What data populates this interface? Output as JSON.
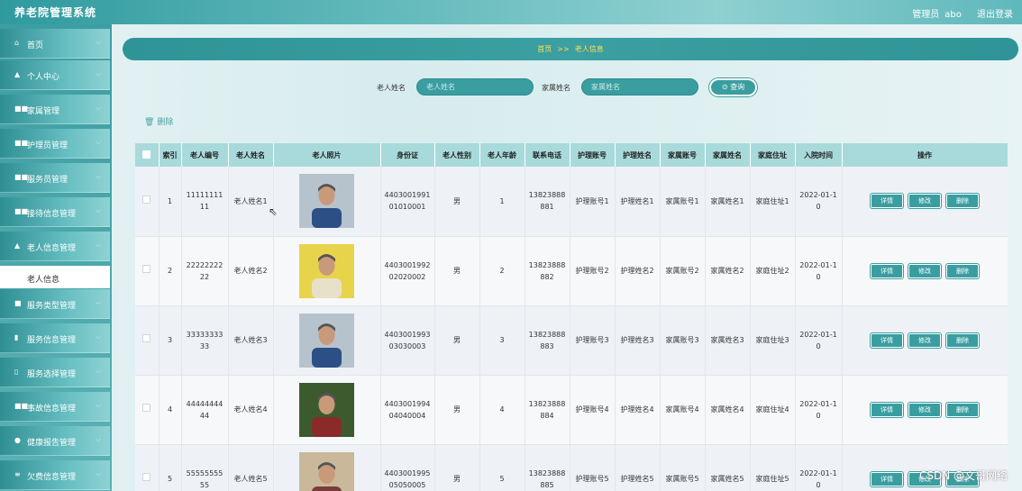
{
  "app": {
    "title": "养老院管理系统"
  },
  "topbar": {
    "role": "管理员",
    "username": "abo",
    "logout": "退出登录"
  },
  "sidebar": {
    "items": [
      {
        "icon": "home-icon",
        "glyph": "⌂",
        "label": "首页"
      },
      {
        "icon": "user-icon",
        "glyph": "▲",
        "label": "个人中心"
      },
      {
        "icon": "grid-icon",
        "glyph": "■■",
        "label": "家属管理"
      },
      {
        "icon": "grid-icon",
        "glyph": "■■",
        "label": "护理员管理"
      },
      {
        "icon": "grid-icon",
        "glyph": "■■",
        "label": "服务员管理"
      },
      {
        "icon": "grid-icon",
        "glyph": "■■",
        "label": "接待信息管理"
      },
      {
        "icon": "house-icon",
        "glyph": "▲",
        "label": "老人信息管理"
      },
      {
        "icon": "list-icon",
        "glyph": "■",
        "label": "服务类型管理"
      },
      {
        "icon": "chart-icon",
        "glyph": "▮",
        "label": "服务信息管理"
      },
      {
        "icon": "doc-icon",
        "glyph": "▯",
        "label": "服务选择管理"
      },
      {
        "icon": "grid-icon",
        "glyph": "■■",
        "label": "事故信息管理"
      },
      {
        "icon": "pin-icon",
        "glyph": "●",
        "label": "健康报告管理"
      },
      {
        "icon": "menu-icon",
        "glyph": "≡",
        "label": "欠费信息管理"
      }
    ],
    "sub_item": "老人信息"
  },
  "breadcrumb": {
    "home": "首页",
    "sep": ">>",
    "current": "老人信息"
  },
  "search": {
    "elder_label": "老人姓名",
    "elder_placeholder": "老人姓名",
    "family_label": "家属姓名",
    "family_placeholder": "家属姓名",
    "button": "查询"
  },
  "toolbar": {
    "delete": "删除"
  },
  "table": {
    "headers": [
      "索引",
      "老人编号",
      "老人姓名",
      "老人照片",
      "身份证",
      "老人性别",
      "老人年龄",
      "联系电话",
      "护理账号",
      "护理姓名",
      "家属账号",
      "家属姓名",
      "家庭住址",
      "入院时间",
      "操作"
    ],
    "rows": [
      {
        "idx": "1",
        "no": "1111111111",
        "name": "老人姓名1",
        "id": "440300199101010001",
        "sex": "男",
        "age": "1",
        "phone": "13823888881",
        "nurse_acc": "护理账号1",
        "nurse_name": "护理姓名1",
        "family_acc": "家属账号1",
        "family_name": "家属姓名1",
        "addr": "家庭住址1",
        "date": "2022-01-10"
      },
      {
        "idx": "2",
        "no": "2222222222",
        "name": "老人姓名2",
        "id": "440300199202020002",
        "sex": "男",
        "age": "2",
        "phone": "13823888882",
        "nurse_acc": "护理账号2",
        "nurse_name": "护理姓名2",
        "family_acc": "家属账号2",
        "family_name": "家属姓名2",
        "addr": "家庭住址2",
        "date": "2022-01-10"
      },
      {
        "idx": "3",
        "no": "3333333333",
        "name": "老人姓名3",
        "id": "440300199303030003",
        "sex": "男",
        "age": "3",
        "phone": "13823888883",
        "nurse_acc": "护理账号3",
        "nurse_name": "护理姓名3",
        "family_acc": "家属账号3",
        "family_name": "家属姓名3",
        "addr": "家庭住址3",
        "date": "2022-01-10"
      },
      {
        "idx": "4",
        "no": "4444444444",
        "name": "老人姓名4",
        "id": "440300199404040004",
        "sex": "男",
        "age": "4",
        "phone": "13823888884",
        "nurse_acc": "护理账号4",
        "nurse_name": "护理姓名4",
        "family_acc": "家属账号4",
        "family_name": "家属姓名4",
        "addr": "家庭住址4",
        "date": "2022-01-10"
      },
      {
        "idx": "5",
        "no": "5555555555",
        "name": "老人姓名5",
        "id": "440300199505050005",
        "sex": "男",
        "age": "5",
        "phone": "13823888885",
        "nurse_acc": "护理账号5",
        "nurse_name": "护理姓名5",
        "family_acc": "家属账号5",
        "family_name": "家属姓名5",
        "addr": "家庭住址5",
        "date": "2022-01-10"
      }
    ],
    "actions": {
      "detail": "详情",
      "edit": "修改",
      "delete": "删除"
    }
  },
  "watermark": "CSDN @文哥网络",
  "colors": {
    "accent": "#3a9ea1",
    "header": "#a9dadb",
    "breadcrumb_text": "#ffe14d"
  }
}
